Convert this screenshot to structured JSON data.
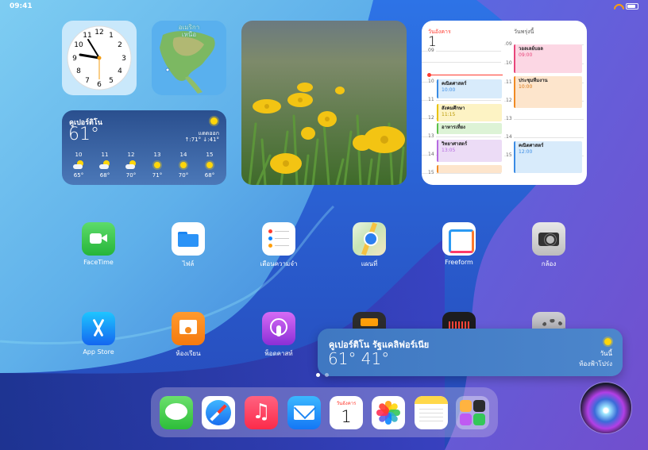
{
  "status_bar": {
    "time": "09:41"
  },
  "colors": {
    "wallpaper_light": "#7fd0f0",
    "wallpaper_blue": "#2a62d8",
    "wallpaper_purple": "#6a52d0",
    "accent_red": "#ff3b30"
  },
  "widgets": {
    "map": {
      "label": "อเมริกา\nเหนือ"
    },
    "weather": {
      "city": "คูเปอร์ติโน",
      "temp": "61°",
      "condition": "แดดออก",
      "hilo": "↑:71° ↓:41°",
      "hours": [
        {
          "time": "10",
          "icon": "partly-cloudy-icon",
          "temp": "65°"
        },
        {
          "time": "11",
          "icon": "partly-cloudy-icon",
          "temp": "68°"
        },
        {
          "time": "12",
          "icon": "partly-cloudy-icon",
          "temp": "70°"
        },
        {
          "time": "13",
          "icon": "sun-icon",
          "temp": "71°"
        },
        {
          "time": "14",
          "icon": "sun-icon",
          "temp": "70°"
        },
        {
          "time": "15",
          "icon": "sun-icon",
          "temp": "68°"
        }
      ]
    },
    "calendar": {
      "today_label": "วันอังคาร",
      "today_num": "1",
      "tomorrow_label": "วันพรุ่งนี้",
      "left_hours": [
        "09",
        "10",
        "11",
        "12",
        "13",
        "14",
        "15"
      ],
      "right_hours": [
        "09",
        "10",
        "11",
        "12",
        "13",
        "14",
        "15"
      ],
      "left_events": [
        {
          "title": "คณิตศาสตร์",
          "time": "10:00",
          "color": "blue"
        },
        {
          "title": "สังคมศึกษา",
          "time": "11:15",
          "color": "yellow"
        },
        {
          "title": "อาหารเที่ยง",
          "time": "",
          "color": "green"
        },
        {
          "title": "วิทยาศาสตร์",
          "time": "13:05",
          "color": "purple"
        }
      ],
      "right_events": [
        {
          "title": "วอลเลย์บอล",
          "time": "09:00",
          "color": "pink"
        },
        {
          "title": "ประชุมทีมงาน",
          "time": "10:00",
          "color": "orange"
        },
        {
          "title": "คณิตศาสตร์",
          "time": "12:00",
          "color": "blue"
        }
      ]
    }
  },
  "apps_row1": [
    {
      "label": "FaceTime",
      "icon": "facetime-icon"
    },
    {
      "label": "ไฟล์",
      "icon": "files-icon"
    },
    {
      "label": "เตือนความจำ",
      "icon": "reminders-icon"
    },
    {
      "label": "แผนที่",
      "icon": "maps-icon"
    },
    {
      "label": "Freeform",
      "icon": "freeform-icon"
    },
    {
      "label": "กล้อง",
      "icon": "camera-icon"
    }
  ],
  "apps_row2": [
    {
      "label": "App Store",
      "icon": "app-store-icon"
    },
    {
      "label": "ห้องเรียน",
      "icon": "classroom-icon"
    },
    {
      "label": "พ็อดคาสท์",
      "icon": "podcasts-icon"
    }
  ],
  "siri_card": {
    "city": "คูเปอร์ติโน รัฐแคลิฟอร์เนีย",
    "temps": "61° 41°",
    "today": "วันนี้",
    "condition": "ท้องฟ้าโปร่ง"
  },
  "dock": {
    "calendar_day": "วันอังคาร",
    "calendar_num": "1",
    "items": [
      "messages-icon",
      "safari-icon",
      "music-icon",
      "mail-icon",
      "calendar-icon",
      "photos-icon",
      "notes-icon",
      "app-library-icon"
    ]
  }
}
